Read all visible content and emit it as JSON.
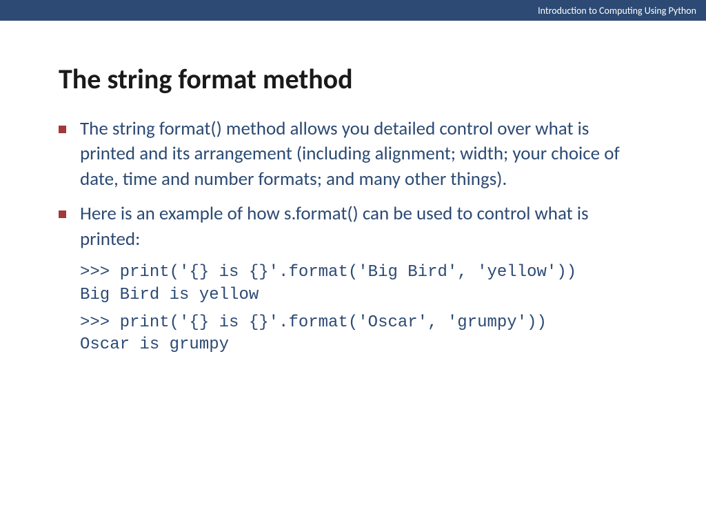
{
  "header": {
    "course_title": "Introduction to Computing Using Python"
  },
  "slide": {
    "title": "The string format method",
    "bullets": [
      "The string format() method allows you detailed control over what is printed and its arrangement (including alignment; width; your choice of date, time and number formats; and many other things).",
      "Here is an example of how s.format() can be used to control what is printed:"
    ],
    "code": {
      "group1": {
        "line1": ">>> print('{} is {}'.format('Big Bird', 'yellow'))",
        "line2": "Big Bird is yellow"
      },
      "group2": {
        "line1": ">>> print('{} is {}'.format('Oscar', 'grumpy'))",
        "line2": "Oscar is grumpy"
      }
    }
  },
  "colors": {
    "header_bg": "#2c4a73",
    "bullet_marker": "#a33838",
    "text": "#2c4a73"
  }
}
